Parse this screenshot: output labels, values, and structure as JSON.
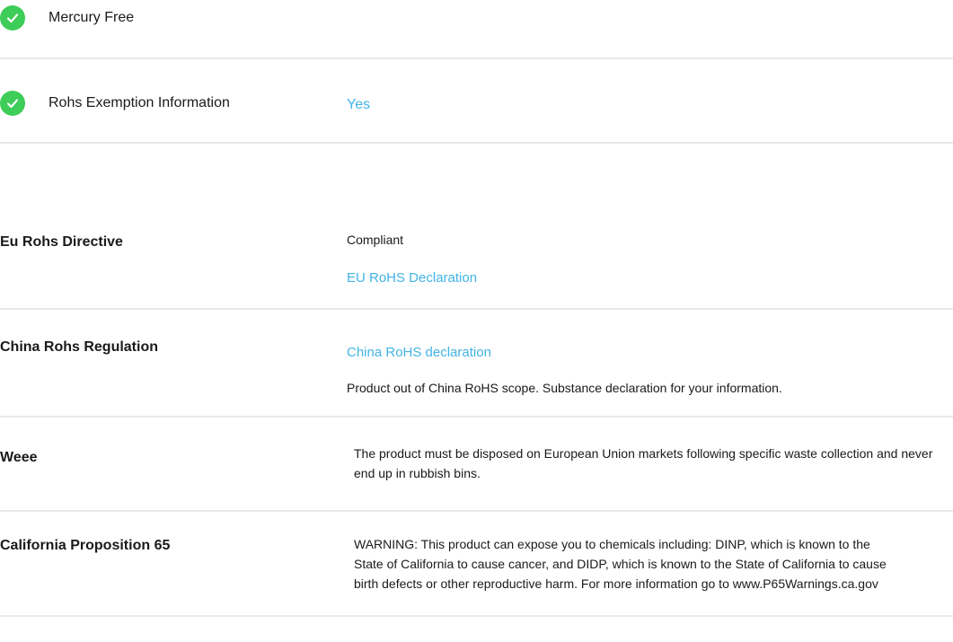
{
  "icons": {
    "check": "check-circle-icon"
  },
  "colors": {
    "accent_green": "#3dcd58",
    "link_blue": "#42b4e6"
  },
  "top_items": [
    {
      "label": "Mercury Free",
      "value": ""
    },
    {
      "label": "Rohs Exemption Information",
      "value": "Yes"
    }
  ],
  "details": {
    "eu_rohs": {
      "label": "Eu Rohs Directive",
      "status": "Compliant",
      "link": "EU RoHS Declaration"
    },
    "china_rohs": {
      "label": "China Rohs Regulation",
      "link": "China RoHS declaration",
      "note": "Product out of China RoHS scope. Substance declaration for your information."
    },
    "weee": {
      "label": "Weee",
      "text": "The product must be disposed on European Union markets following specific waste collection and never end up in rubbish bins."
    },
    "prop65": {
      "label": "California Proposition 65",
      "text": "WARNING: This product can expose you to chemicals including: DINP, which is known to the State of California to cause cancer, and DIDP, which is known to the State of California to cause birth defects or other reproductive harm. For more information go to www.P65Warnings.ca.gov"
    }
  }
}
